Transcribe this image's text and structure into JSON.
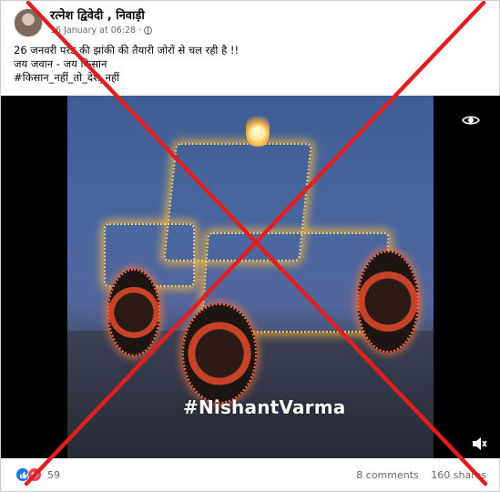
{
  "post": {
    "author": "रत्नेश द्विवेदी , निवाड़ी",
    "date": "16 January at 06:28",
    "separator": "·",
    "caption_lines": [
      "26 जनवरी परेड की झांकी की तैयारी जोरों से चल रही है !!",
      "जय जवान - जय किसान",
      "#किसान_नहीं_तो_देश_नहीं"
    ]
  },
  "video": {
    "watermark": "#NishantVarma",
    "eye_icon": "eye-icon",
    "volume_icon": "speaker-icon"
  },
  "footer": {
    "reaction_count": "59",
    "comments": "8 comments",
    "shares": "160 shares",
    "like_icon": "thumbs-up-icon",
    "love_icon": "heart-icon"
  },
  "overlay": {
    "cross_color": "#e02020"
  }
}
